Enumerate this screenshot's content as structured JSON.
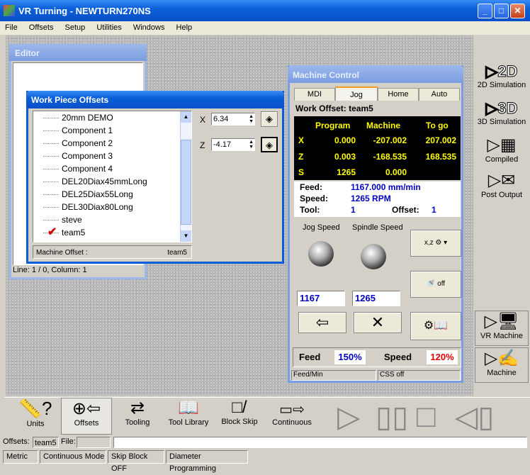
{
  "app": {
    "title": "VR Turning - NEWTURN270NS",
    "min": "_",
    "max": "□",
    "close": "✕"
  },
  "menu": [
    "File",
    "Offsets",
    "Setup",
    "Utilities",
    "Windows",
    "Help"
  ],
  "editor": {
    "title": "Editor",
    "status": "Line: 1 / 0, Column: 1"
  },
  "offsets": {
    "title": "Work Piece Offsets",
    "items": [
      "20mm DEMO",
      "Component 1",
      "Component 2",
      "Component 3",
      "Component 4",
      "DEL20Diax45mmLong",
      "DEL25Diax55Long",
      "DEL30Diax80Long",
      "steve",
      "team5"
    ],
    "x_label": "X",
    "x_value": "6.34",
    "z_label": "Z",
    "z_value": "-4.17",
    "machine_offset_label": "Machine Offset :",
    "machine_offset_value": "team5"
  },
  "machine": {
    "title": "Machine Control",
    "tabs": [
      "MDI",
      "Jog",
      "Home",
      "Auto"
    ],
    "work_offset": "Work Offset: team5",
    "head": [
      "Program",
      "Machine",
      "To go"
    ],
    "rows": [
      [
        "X",
        "0.000",
        "-207.002",
        "207.002"
      ],
      [
        "Z",
        "0.003",
        "-168.535",
        "168.535"
      ],
      [
        "S",
        "1265",
        "0.000",
        ""
      ]
    ],
    "feed_label": "Feed:",
    "feed_value": "1167.000 mm/min",
    "speed_label": "Speed:",
    "speed_value": "1265 RPM",
    "tool_label": "Tool:",
    "tool_value": "1",
    "offset_label": "Offset:",
    "offset_value": "1",
    "jog_speed": "Jog Speed",
    "spindle_speed": "Spindle Speed",
    "jog_value": "1167",
    "spindle_value": "1265",
    "feed_override_label": "Feed",
    "feed_override": "150%",
    "speed_override_label": "Speed",
    "speed_override": "120%",
    "status1": "Feed/Min",
    "status2": "CSS off"
  },
  "right": [
    "2D Simulation",
    "3D Simulation",
    "Compiled",
    "Post Output",
    "VR Machine",
    "Machine"
  ],
  "bottom": [
    "Units",
    "Offsets",
    "Tooling",
    "Tool Library",
    "Block Skip",
    "Continuous"
  ],
  "offsetsbar": {
    "label": "Offsets:",
    "value": "team5",
    "file": "File:"
  },
  "status": [
    "Metric",
    "Continuous Mode",
    "Skip Block OFF",
    "Diameter Programming"
  ],
  "colors": {
    "accent": "#0a5fd8",
    "dro_bg": "#000000",
    "dro_text": "#ffff00",
    "feed_override": "#0000c0",
    "speed_override": "#e00000"
  }
}
